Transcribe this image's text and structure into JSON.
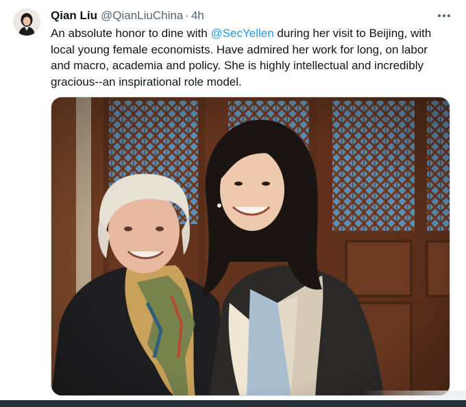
{
  "author": {
    "name": "Qian Liu",
    "handle": "@QianLiuChina",
    "separator": "·",
    "time": "4h"
  },
  "tweet": {
    "line1_before": "An absolute honor to dine with ",
    "mention": "@SecYellen",
    "line1_after": " during her visit to Beijing, with",
    "line2": "local young female economists. Have admired her work for long, on labor",
    "line3": "and macro, academia and policy. She is highly intellectual and incredibly",
    "line4": "gracious--an inspirational role model."
  },
  "colors": {
    "mention": "#1d9bf0",
    "secondary_text": "#536471",
    "primary_text": "#0f1419"
  },
  "icons": {
    "more": "more-horizontal-icon"
  }
}
